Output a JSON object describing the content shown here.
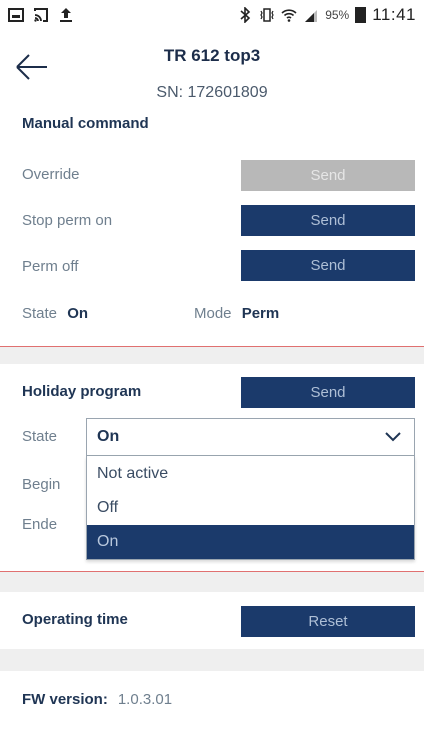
{
  "statusbar": {
    "icons_left": [
      "image-icon",
      "cast-icon",
      "upload-icon"
    ],
    "icons_right": [
      "bluetooth-icon",
      "vibrate-icon",
      "wifi-icon",
      "signal-icon"
    ],
    "battery_pct": "95%",
    "time": "11:41"
  },
  "header": {
    "title": "TR 612 top3",
    "serial": "SN: 172601809"
  },
  "manual": {
    "title": "Manual command",
    "rows": [
      {
        "label": "Override",
        "button": "Send",
        "enabled": false
      },
      {
        "label": "Stop perm on",
        "button": "Send",
        "enabled": true
      },
      {
        "label": "Perm off",
        "button": "Send",
        "enabled": true
      }
    ],
    "state_label": "State",
    "state_value": "On",
    "mode_label": "Mode",
    "mode_value": "Perm"
  },
  "holiday": {
    "title": "Holiday program",
    "send_label": "Send",
    "state_label": "State",
    "begin_label": "Begin",
    "end_label": "Ende",
    "dropdown": {
      "selected": "On",
      "options": [
        "Not active",
        "Off",
        "On"
      ]
    }
  },
  "operating": {
    "title": "Operating time",
    "reset_label": "Reset"
  },
  "fw": {
    "label": "FW version:",
    "value": "1.0.3.01"
  },
  "colors": {
    "accent": "#1b3a6b",
    "disabled": "#b8b8b8",
    "section_gap": "#efefef"
  }
}
